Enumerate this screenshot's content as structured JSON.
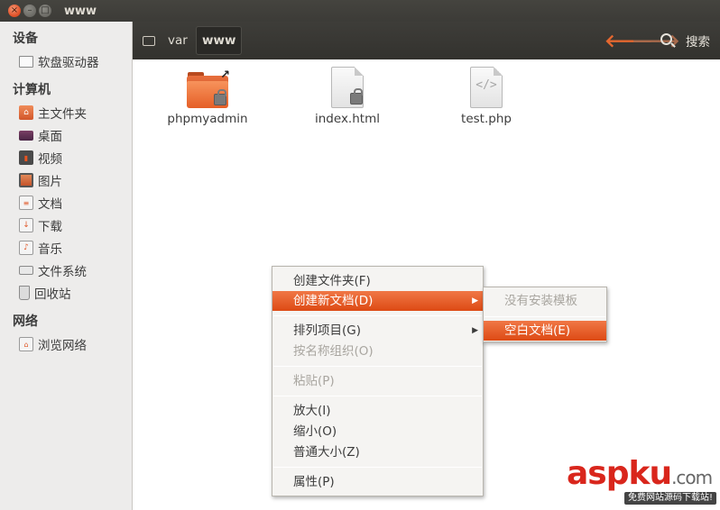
{
  "window": {
    "title": "www",
    "close_glyph": "×",
    "minimize_glyph": "–",
    "maximize_glyph": "□"
  },
  "sidebar": {
    "sections": [
      {
        "heading": "设备",
        "items": [
          {
            "label": "软盘驱动器",
            "icon": "floppy-icon"
          }
        ]
      },
      {
        "heading": "计算机",
        "items": [
          {
            "label": "主文件夹",
            "icon": "home-folder-icon"
          },
          {
            "label": "桌面",
            "icon": "desktop-icon"
          },
          {
            "label": "视频",
            "icon": "video-icon"
          },
          {
            "label": "图片",
            "icon": "pictures-icon"
          },
          {
            "label": "文档",
            "icon": "documents-icon"
          },
          {
            "label": "下载",
            "icon": "downloads-icon"
          },
          {
            "label": "音乐",
            "icon": "music-icon"
          },
          {
            "label": "文件系统",
            "icon": "filesystem-icon"
          },
          {
            "label": "回收站",
            "icon": "trash-icon"
          }
        ]
      },
      {
        "heading": "网络",
        "items": [
          {
            "label": "浏览网络",
            "icon": "network-icon"
          }
        ]
      }
    ]
  },
  "toolbar": {
    "breadcrumbs": [
      "var",
      "www"
    ],
    "back_glyph": "🡐",
    "forward_glyph": "🡒",
    "search_label": "搜索"
  },
  "files": [
    {
      "name": "phpmyadmin",
      "type": "folder-link",
      "locked": true
    },
    {
      "name": "index.html",
      "type": "document",
      "locked": true
    },
    {
      "name": "test.php",
      "type": "code",
      "locked": false,
      "glyph": "</>"
    }
  ],
  "context_menu": {
    "items": [
      {
        "label": "创建文件夹(F)",
        "enabled": true
      },
      {
        "label": "创建新文档(D)",
        "enabled": true,
        "active": true,
        "submenu": true
      },
      {
        "label": "排列项目(G)",
        "enabled": true,
        "submenu": true
      },
      {
        "label": "按名称组织(O)",
        "enabled": false
      },
      {
        "label": "粘贴(P)",
        "enabled": false
      },
      {
        "label": "放大(I)",
        "enabled": true
      },
      {
        "label": "缩小(O)",
        "enabled": true
      },
      {
        "label": "普通大小(Z)",
        "enabled": true
      },
      {
        "label": "属性(P)",
        "enabled": true
      }
    ],
    "submenu_arrow": "▶"
  },
  "submenu": {
    "items": [
      {
        "label": "没有安装模板",
        "enabled": false
      },
      {
        "label": "空白文档(E)",
        "enabled": true,
        "active": true
      }
    ]
  },
  "watermark": {
    "logo_asp": "asp",
    "logo_ku": "ku",
    "logo_com": ".com",
    "tagline": "免费网站源码下载站!"
  },
  "colors": {
    "accent": "#e95420",
    "toolbar_bg": "#3c3b37",
    "sidebar_bg": "#edeceb"
  }
}
